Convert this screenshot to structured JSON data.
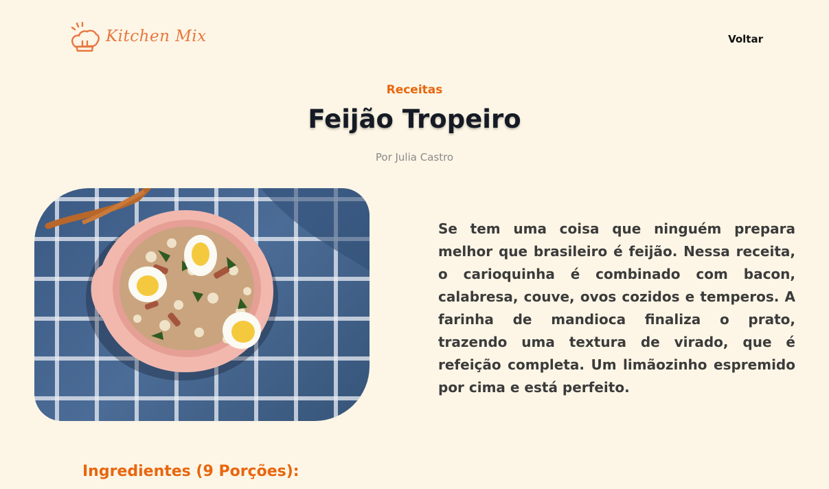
{
  "header": {
    "logo_text": "Kitchen Mix",
    "logo_icon": "chef-hat-icon",
    "back_label": "Voltar"
  },
  "recipe": {
    "category": "Receitas",
    "title": "Feijão Tropeiro",
    "author": "Por Julia Castro",
    "image_alt": "Feijão tropeiro em tigela rosa com ovos cozidos",
    "description": "Se tem uma coisa que ninguém prepara melhor que brasileiro é feijão. Nessa receita, o carioquinha é combinado com bacon, calabresa, couve, ovos cozidos e temperos. A farinha de mandioca finaliza o prato, trazendo uma textura de virado, que é refeição completa. Um limãozinho espremido por cima e está perfeito.",
    "ingredients_heading": "Ingredientes (9 Porções):"
  },
  "colors": {
    "background": "#fdf6e6",
    "accent": "#e8660f",
    "title": "#151a24"
  }
}
